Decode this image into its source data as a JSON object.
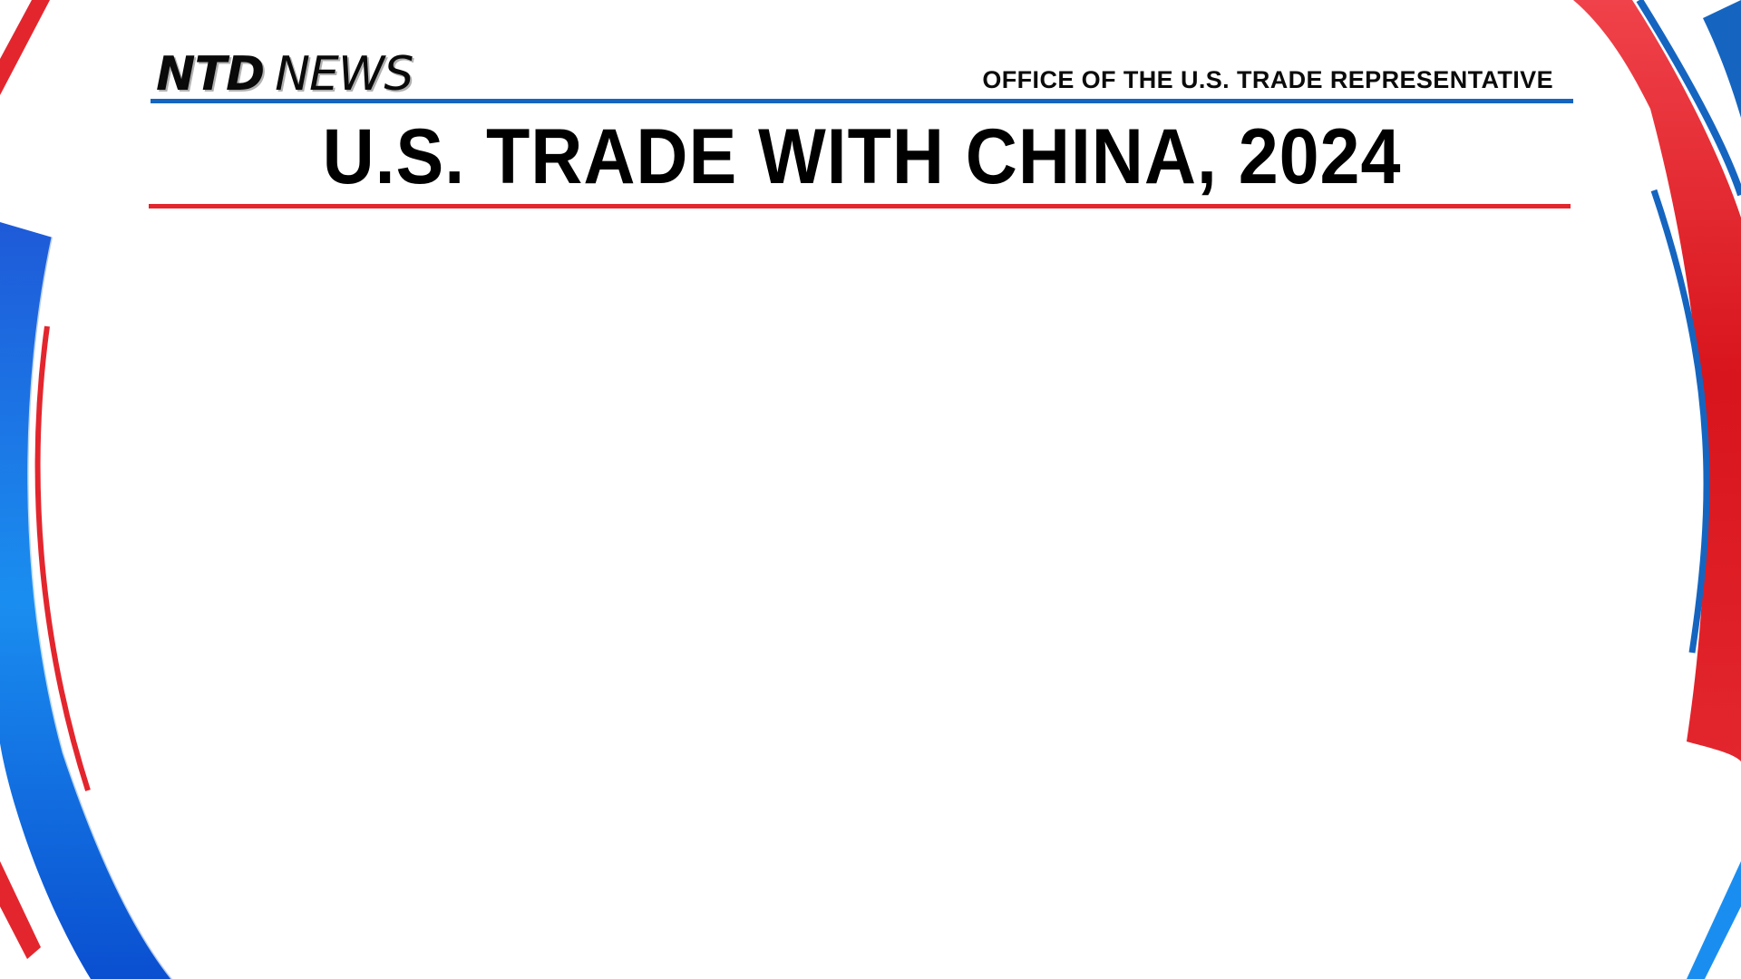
{
  "brand": {
    "logo_ntd": "NTD",
    "logo_news": "NEWS"
  },
  "header": {
    "source": "OFFICE OF THE U.S. TRADE REPRESENTATIVE",
    "title": "U.S. TRADE WITH CHINA, 2024"
  },
  "colors": {
    "accent_blue": "#1565c0",
    "accent_red": "#e3262e",
    "background": "#ffffff",
    "text": "#000000"
  }
}
